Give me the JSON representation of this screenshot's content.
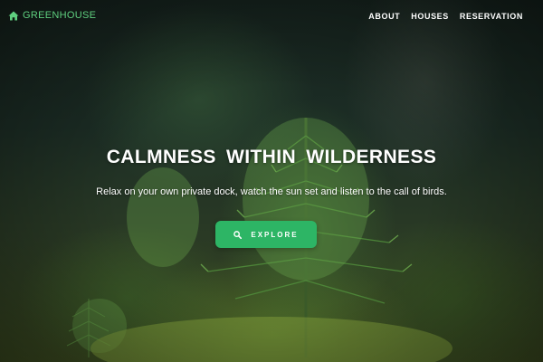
{
  "brand": {
    "name": "GREENHOUSE",
    "icon": "home-icon",
    "color": "#5fcf7f"
  },
  "nav": {
    "items": [
      {
        "label": "ABOUT"
      },
      {
        "label": "HOUSES"
      },
      {
        "label": "RESERVATION"
      }
    ]
  },
  "hero": {
    "title": "CALMNESS WITHIN WILDERNESS",
    "subtitle": "Relax on your own private dock, watch the sun set and listen to the call of birds.",
    "cta": {
      "label": "EXPLORE",
      "icon": "search-icon",
      "color": "#2db565"
    }
  }
}
